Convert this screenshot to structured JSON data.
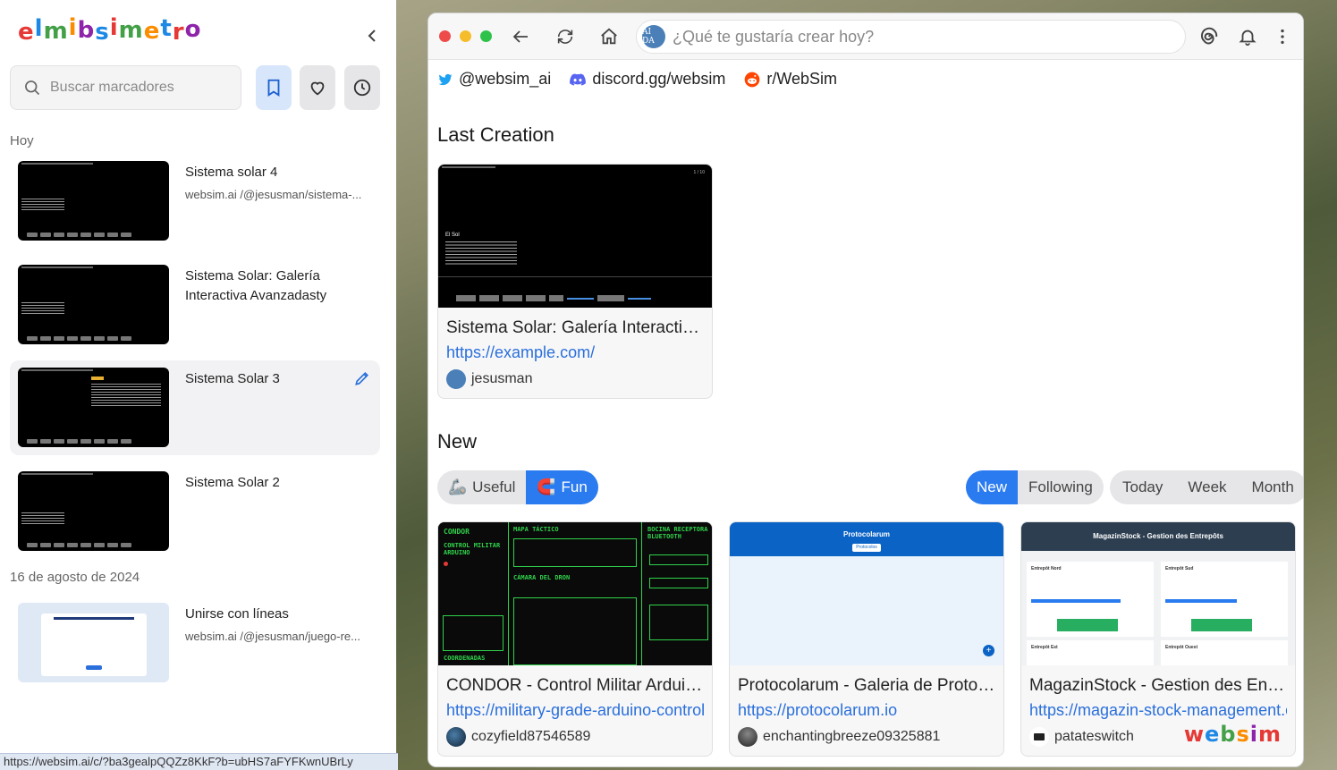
{
  "sidebar": {
    "logo_letters": [
      "e",
      "l",
      "m",
      "i",
      "b",
      "s",
      "i",
      "m",
      "e",
      "t",
      "r",
      "o"
    ],
    "logo_colors": [
      "#e53935",
      "#1e88e5",
      "#43a047",
      "#fb8c00",
      "#8e24aa",
      "#1e88e5",
      "#e53935",
      "#43a047",
      "#fb8c00",
      "#1e88e5",
      "#e53935",
      "#8e24aa"
    ],
    "search_placeholder": "Buscar marcadores",
    "section_today": "Hoy",
    "section_date": "16 de agosto de 2024",
    "bookmarks": [
      {
        "title": "Sistema solar 4",
        "url": "websim.ai /@jesusman/sistema-..."
      },
      {
        "title": "Sistema Solar: Galería Interactiva Avanzadasty",
        "url": ""
      },
      {
        "title": "Sistema Solar 3",
        "url": ""
      },
      {
        "title": "Sistema Solar 2",
        "url": ""
      },
      {
        "title": "Unirse con líneas",
        "url": "websim.ai /@jesusman/juego-re..."
      }
    ]
  },
  "statusbar": {
    "url": "https://websim.ai/c/?ba3gealpQQZz8KkF?b=ubHS7aFYFKwnUBrLy"
  },
  "browser": {
    "address_placeholder": "¿Qué te gustaría crear hoy?",
    "avatar_text": "AI DA"
  },
  "social": {
    "twitter": "@websim_ai",
    "discord": "discord.gg/websim",
    "reddit": "r/WebSim"
  },
  "last_creation": {
    "heading": "Last Creation",
    "card": {
      "title": "Sistema Solar: Galería Interactiva Avanzadasty",
      "url": "https://example.com/",
      "author": "jesusman",
      "thumb_label": "El Sol",
      "thumb_page": "1 / 10"
    }
  },
  "new_section": {
    "heading": "New",
    "category_tabs": [
      {
        "label": "Useful",
        "icon": "🦾"
      },
      {
        "label": "Fun",
        "icon": "🧲"
      }
    ],
    "feed_tabs": [
      "New",
      "Following"
    ],
    "time_tabs": [
      "Today",
      "Week",
      "Month"
    ],
    "cards": [
      {
        "title": "CONDOR - Control Militar Arduino",
        "url": "https://military-grade-arduino-control",
        "author": "cozyfield87546589"
      },
      {
        "title": "Protocolarum - Galeria de Protocolos",
        "url": "https://protocolarum.io",
        "author": "enchantingbreeze09325881",
        "thumb_title": "Protocolarum",
        "thumb_btn": "Protocolos"
      },
      {
        "title": "MagazinStock - Gestion des Entrepôts",
        "url": "https://magazin-stock-management.c",
        "author": "patateswitch",
        "thumb_title": "MagazinStock - Gestion des Entrepôts",
        "thumb_sections": [
          "Entrepôt Nord",
          "Entrepôt Sud",
          "Entrepôt Est",
          "Entrepôt Ouest"
        ]
      }
    ],
    "condor_labels": [
      "CONDOR",
      "MAPA TÁCTICO",
      "BOCINA RECEPTORA BLUETOOTH",
      "CONTROL MILITAR ARDUINO",
      "CÁMARA DEL DRON",
      "COORDENADAS"
    ]
  },
  "watermark": {
    "letters": [
      "w",
      "e",
      "b",
      "s",
      "i",
      "m"
    ],
    "colors": [
      "#e53935",
      "#1e88e5",
      "#43a047",
      "#fb8c00",
      "#8e24aa",
      "#e53935"
    ]
  },
  "colors": {
    "accent": "#2a7bf0",
    "link": "#2a6fdb",
    "terminal_green": "#2fd14a"
  }
}
